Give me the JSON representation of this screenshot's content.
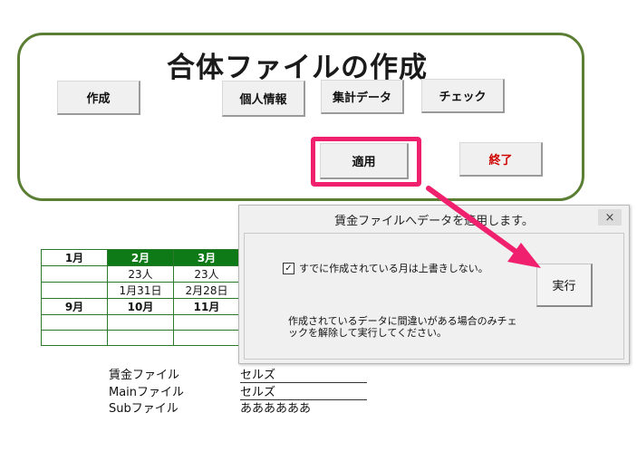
{
  "panel": {
    "title": "合体ファイルの作成",
    "buttons": {
      "create": "作成",
      "personal": "個人情報",
      "aggregate": "集計データ",
      "check": "チェック",
      "apply": "適用",
      "exit": "終了"
    }
  },
  "calendar": {
    "rows": [
      [
        "1月",
        "2月",
        "3月"
      ],
      [
        "",
        "23人",
        "23人"
      ],
      [
        "",
        "1月31日",
        "2月28日"
      ],
      [
        "9月",
        "10月",
        "11月"
      ],
      [
        "",
        "",
        ""
      ],
      [
        "",
        "",
        ""
      ]
    ]
  },
  "files": [
    {
      "label": "賃金ファイル",
      "value": "セルズ"
    },
    {
      "label": "Mainファイル",
      "value": "セルズ"
    },
    {
      "label": "Subファイル",
      "value": "ああああああ"
    }
  ],
  "dialog": {
    "title": "賃金ファイルへデータを適用します。",
    "close": "×",
    "checkbox_label": "すでに作成されている月は上書きしない。",
    "checkbox_checked": true,
    "note": "作成されているデータに間違いがある場合のみチェックを解除して実行してください。",
    "run": "実行"
  },
  "colors": {
    "panel_border": "#5a7f34",
    "highlight": "#f0206e",
    "header_green": "#0e7a17",
    "exit_text": "#d00000"
  }
}
